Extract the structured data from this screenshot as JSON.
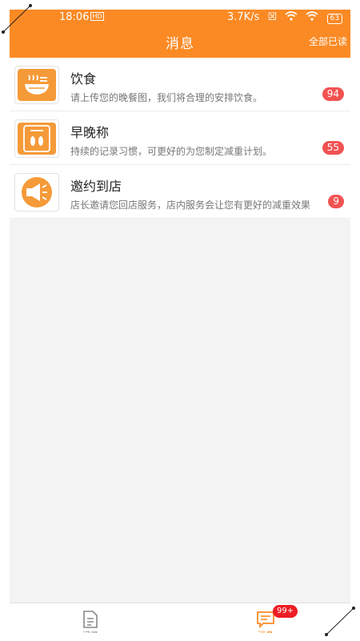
{
  "status_bar": {
    "time": "18:06",
    "network_speed": "3.7K/s",
    "battery": "63"
  },
  "header": {
    "title": "消息",
    "mark_all_read": "全部已读"
  },
  "messages": [
    {
      "title": "饮食",
      "desc": "请上传您的晚餐图，我们将合理的安排饮食。",
      "count": "94",
      "icon": "diet-bowl-icon"
    },
    {
      "title": "早晚称",
      "desc": "持续的记录习惯，可更好的为您制定减重计划。",
      "count": "55",
      "icon": "scale-footprints-icon"
    },
    {
      "title": "邀约到店",
      "desc": "店长邀请您回店服务，店内服务会让您有更好的减重效果",
      "count": "9",
      "icon": "megaphone-icon"
    }
  ],
  "tabbar": {
    "tabs": [
      {
        "label": "记录",
        "icon": "document-icon",
        "active": false
      },
      {
        "label": "消息",
        "icon": "message-icon",
        "active": true
      }
    ],
    "message_badge": "99+"
  },
  "colors": {
    "accent": "#fb8a24",
    "badge": "#f25252",
    "background": "#f3f3f3"
  }
}
